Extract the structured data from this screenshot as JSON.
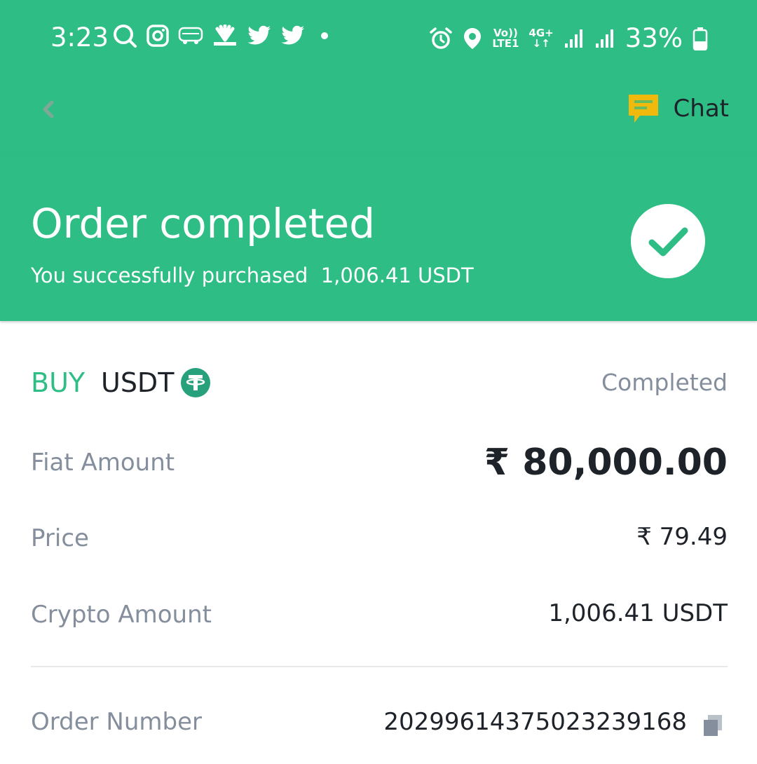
{
  "status_bar": {
    "time": "3:23",
    "battery": "33%",
    "network_top": "Vo))",
    "network_bottom": "LTE1",
    "signal_label": "4G+",
    "icons_left": [
      "search-icon",
      "instagram-icon",
      "redbus-icon",
      "cnbc-icon",
      "twitter-icon",
      "twitter-icon",
      "dot-icon"
    ],
    "icons_right": [
      "alarm-icon",
      "location-icon",
      "volte-icon",
      "signal-icon",
      "signal-icon",
      "battery-icon"
    ]
  },
  "nav": {
    "back_icon": "chevron-left-icon",
    "chat_icon": "chat-bubble-icon",
    "chat_label": "Chat"
  },
  "banner": {
    "title": "Order completed",
    "subtitle": "You successfully purchased  1,006.41 USDT",
    "icon": "check-icon"
  },
  "order": {
    "side": "BUY",
    "asset": "USDT",
    "asset_icon": "tether-icon",
    "status": "Completed",
    "fiat_amount_label": "Fiat Amount",
    "fiat_amount_value": "₹ 80,000.00",
    "price_label": "Price",
    "price_value": "₹ 79.49",
    "crypto_amount_label": "Crypto Amount",
    "crypto_amount_value": "1,006.41 USDT",
    "order_number_label": "Order Number",
    "order_number_value": "20299614375023239168",
    "copy_icon": "copy-icon"
  },
  "colors": {
    "accent": "#2ebd85",
    "text_primary": "#1e2329",
    "text_secondary": "#848e9c",
    "chat_icon": "#f0b90b"
  }
}
